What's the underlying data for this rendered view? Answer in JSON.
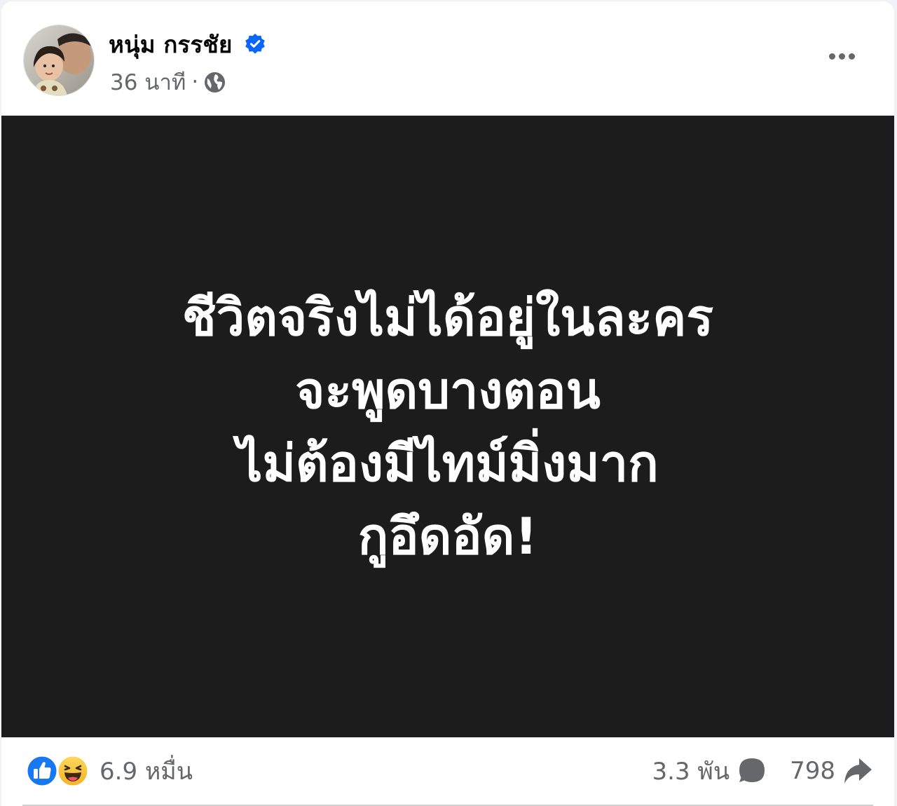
{
  "post": {
    "author": {
      "name": "หนุ่ม กรรชัย",
      "verified": true,
      "avatar_icon": "profile-photo"
    },
    "meta": {
      "time": "36 นาที",
      "separator": "·",
      "audience_icon": "globe-icon"
    },
    "more_icon": "more-options-icon",
    "image": {
      "background": "#1c1c1c",
      "lines": [
        "ชีวิตจริงไม่ได้อยู่ในละคร",
        "จะพูดบางตอน",
        "ไม่ต้องมีไทม์มิ่งมาก",
        "กูอึดอัด!"
      ]
    },
    "footer": {
      "reaction_icons": [
        "like-icon",
        "haha-icon"
      ],
      "reaction_count": "6.9 หมื่น",
      "comment_count": "3.3 พัน",
      "comment_icon": "comment-icon",
      "share_count": "798",
      "share_icon": "share-icon"
    }
  },
  "colors": {
    "verified_blue": "#0866ff",
    "secondary_text": "#65676b",
    "like_blue": "#1877f2",
    "haha_yellow": "#f7b125"
  }
}
